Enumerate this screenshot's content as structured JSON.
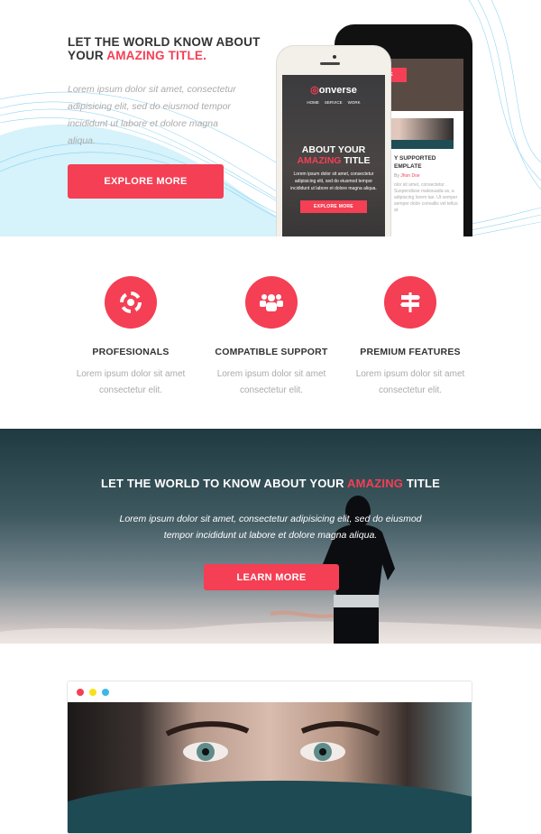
{
  "hero": {
    "title_line1": "LET THE WORLD KNOW ABOUT",
    "title_line2_prefix": "YOUR ",
    "title_highlight": "AMAZING TITLE.",
    "text": "Lorem ipsum dolor sit amet, consectetur adipisicing elit, sed do eiusmod tempor incididunt ut labore et dolore magna aliqua.",
    "button": "EXPLORE MORE"
  },
  "phone_front": {
    "logo": "onverse",
    "nav": [
      "HOME",
      "SERVICE",
      "WORK"
    ],
    "title1": "ABOUT YOUR",
    "title_highlight": "AMAZING",
    "title2": " TITLE",
    "text": "Lorem ipsum dolor sit amet, consectetur adipisicing elit, sed do eiusmod tempor incididunt ut labore et dolore magna aliqua.",
    "button": "EXPLORE MORE"
  },
  "phone_back": {
    "button": "PLORE MORE",
    "heading1": "Y SUPPORTED",
    "heading2": "EMPLATE",
    "author_prefix": "By ",
    "author": "Jhon Doe",
    "text": "olor sit amet, consectetur . Suspendisse malesuada us, a adipiscing lorem tae. Ut semper semper dolor convallis vel tellus at"
  },
  "features": [
    {
      "icon": "life-ring-icon",
      "title": "PROFESIONALS",
      "text": "Lorem ipsum dolor sit amet consectetur elit."
    },
    {
      "icon": "users-icon",
      "title": "COMPATIBLE SUPPORT",
      "text": "Lorem ipsum dolor sit amet consectetur elit."
    },
    {
      "icon": "signpost-icon",
      "title": "PREMIUM FEATURES",
      "text": "Lorem ipsum dolor sit amet consectetur elit."
    }
  ],
  "banner": {
    "title_prefix": "LET THE WORLD TO KNOW ABOUT YOUR ",
    "title_highlight": "AMAZING",
    "title_suffix": " TITLE",
    "text": "Lorem ipsum dolor sit amet, consectetur adipisicing elit, sed do eiusmod tempor incididunt ut labore et dolore magna aliqua.",
    "button": "LEARN MORE"
  },
  "browser": {
    "dot_colors": [
      "#f43f54",
      "#f5e21b",
      "#3bb8e8"
    ]
  },
  "colors": {
    "accent": "#f43f54"
  }
}
